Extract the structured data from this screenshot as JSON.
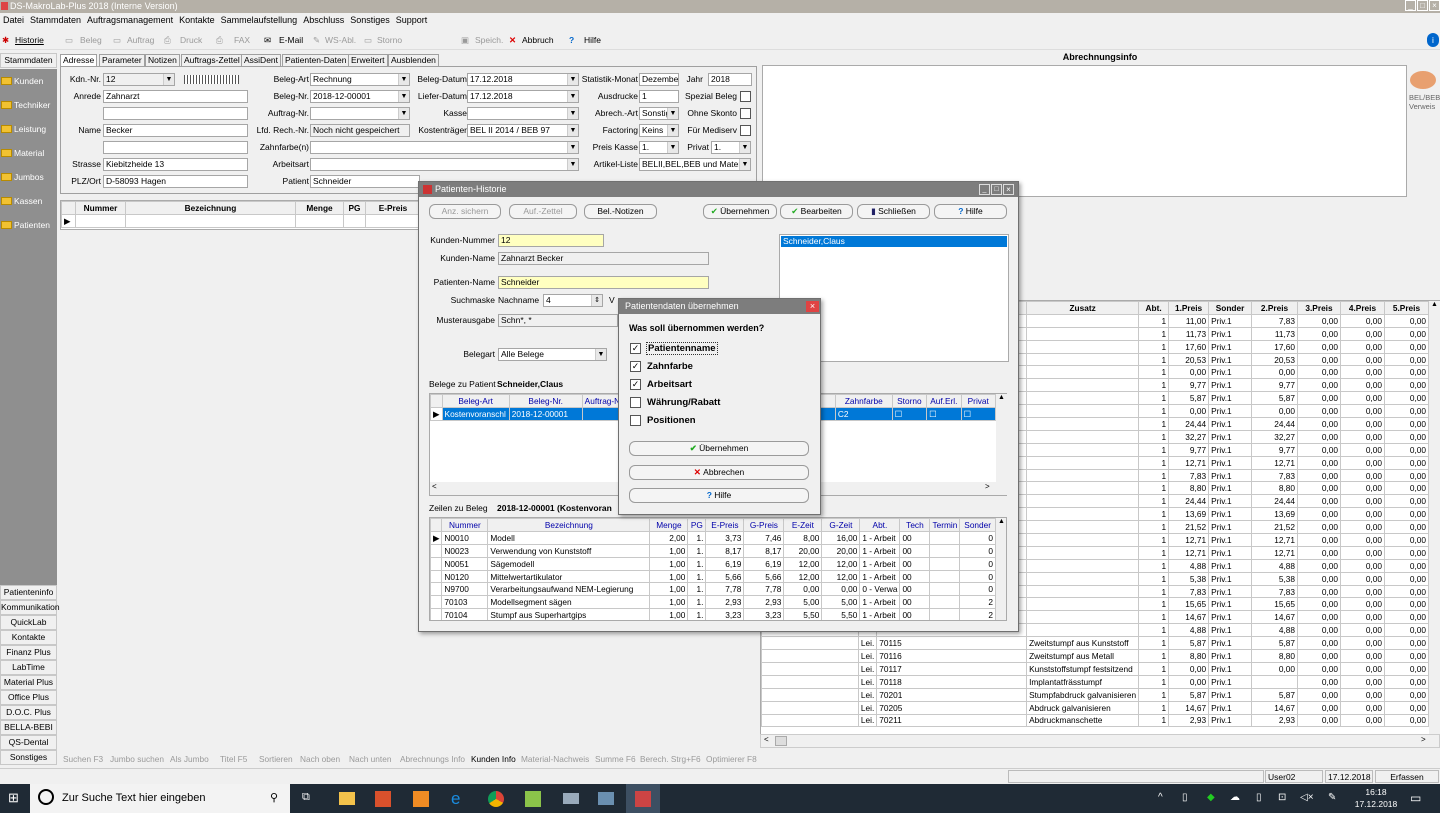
{
  "app": {
    "title": "DS-MakroLab-Plus 2018 (Interne Version)"
  },
  "menu": [
    "Datei",
    "Stammdaten",
    "Auftragsmanagement",
    "Kontakte",
    "Sammelaufstellung",
    "Abschluss",
    "Sonstiges",
    "Support"
  ],
  "toolbar": {
    "historie": "Historie",
    "beleg": "Beleg",
    "auftrag": "Auftrag",
    "druck": "Druck",
    "fax": "FAX",
    "email": "E-Mail",
    "wsabl": "WS-Abl.",
    "storno": "Storno",
    "speich": "Speich.",
    "abbruch": "Abbruch",
    "hilfe": "Hilfe"
  },
  "sidebar": {
    "header": "Stammdaten",
    "items": [
      "Kunden",
      "Techniker",
      "Leistung",
      "Material",
      "Jumbos",
      "Kassen",
      "Patienten"
    ],
    "bottom": [
      "Patienteninfo",
      "Kommunikation",
      "QuickLab",
      "Kontakte",
      "Finanz Plus",
      "LabTime",
      "Material Plus",
      "Office Plus",
      "D.O.C. Plus",
      "BELLA-BEBI",
      "QS-Dental",
      "Sonstiges"
    ]
  },
  "tabs": [
    "Adresse",
    "Parameter",
    "Notizen",
    "Auftrags-Zettel",
    "AssiDent",
    "Patienten-Daten",
    "Erweitert",
    "Ausblenden"
  ],
  "form": {
    "kdnr_label": "Kdn.-Nr.",
    "kdnr": "12",
    "anrede_label": "Anrede",
    "anrede": "Zahnarzt",
    "name_label": "Name",
    "name": "Becker",
    "strasse_label": "Strasse",
    "strasse": "Kiebitzheide 13",
    "plz_label": "PLZ/Ort",
    "plz": "D-58093 Hagen",
    "belegart_label": "Beleg-Art",
    "belegart": "Rechnung",
    "belegnr_label": "Beleg-Nr.",
    "belegnr": "2018-12-00001",
    "auftragnr_label": "Auftrag-Nr.",
    "lfdrech_label": "Lfd. Rech.-Nr.",
    "lfdrech": "Noch nicht gespeichert",
    "zahnfarbe_label": "Zahnfarbe(n)",
    "arbeitsart_label": "Arbeitsart",
    "patient_label": "Patient",
    "patient": "Schneider",
    "belegdatum_label": "Beleg-Datum",
    "belegdatum": "17.12.2018",
    "lieferdatum_label": "Liefer-Datum",
    "lieferdatum": "17.12.2018",
    "kasse_label": "Kasse",
    "kostentraeger_label": "Kostenträger",
    "kostentraeger": "BEL II 2014 / BEB 97",
    "statistik_label": "Statistik-Monat",
    "statistik": "Dezember",
    "jahr_label": "Jahr",
    "jahr": "2018",
    "ausdrucke_label": "Ausdrucke",
    "ausdrucke": "1",
    "abrechart_label": "Abrech.-Art",
    "abrechart": "Sonstig",
    "factoring_label": "Factoring",
    "factoring": "Keins",
    "preiskasse_label": "Preis Kasse",
    "preiskasse": "1.",
    "privat_label": "Privat",
    "privat": "1.",
    "artikelliste_label": "Artikel-Liste",
    "artikelliste": "BELII,BEL,BEB und Materi",
    "spezial_label": "Spezial Beleg",
    "skonto_label": "Ohne Skonto",
    "mediserv_label": "Für Mediserv"
  },
  "abrechnungsinfo": {
    "title": "Abrechnungsinfo",
    "icon_label": "BEL/BEB Verweis"
  },
  "main_grid": {
    "headers": [
      "Nummer",
      "Bezeichnung",
      "Menge",
      "PG",
      "E-Preis"
    ]
  },
  "right_grid": {
    "headers": [
      "Zusatz",
      "Abt.",
      "1.Preis",
      "Sonder",
      "2.Preis",
      "3.Preis",
      "4.Preis",
      "5.Preis"
    ],
    "rows": [
      [
        "1",
        "11,00",
        "Priv.1",
        "7,83",
        "0,00",
        "0,00",
        "0,00"
      ],
      [
        "1",
        "11,73",
        "Priv.1",
        "11,73",
        "0,00",
        "0,00",
        "0,00"
      ],
      [
        "1",
        "17,60",
        "Priv.1",
        "17,60",
        "0,00",
        "0,00",
        "0,00"
      ],
      [
        "1",
        "20,53",
        "Priv.1",
        "20,53",
        "0,00",
        "0,00",
        "0,00"
      ],
      [
        "1",
        "0,00",
        "Priv.1",
        "0,00",
        "0,00",
        "0,00",
        "0,00"
      ],
      [
        "1",
        "9,77",
        "Priv.1",
        "9,77",
        "0,00",
        "0,00",
        "0,00"
      ],
      [
        "1",
        "5,87",
        "Priv.1",
        "5,87",
        "0,00",
        "0,00",
        "0,00"
      ],
      [
        "1",
        "0,00",
        "Priv.1",
        "0,00",
        "0,00",
        "0,00",
        "0,00"
      ],
      [
        "1",
        "24,44",
        "Priv.1",
        "24,44",
        "0,00",
        "0,00",
        "0,00"
      ],
      [
        "1",
        "32,27",
        "Priv.1",
        "32,27",
        "0,00",
        "0,00",
        "0,00"
      ],
      [
        "1",
        "9,77",
        "Priv.1",
        "9,77",
        "0,00",
        "0,00",
        "0,00"
      ],
      [
        "1",
        "12,71",
        "Priv.1",
        "12,71",
        "0,00",
        "0,00",
        "0,00"
      ],
      [
        "1",
        "7,83",
        "Priv.1",
        "7,83",
        "0,00",
        "0,00",
        "0,00"
      ],
      [
        "1",
        "8,80",
        "Priv.1",
        "8,80",
        "0,00",
        "0,00",
        "0,00"
      ],
      [
        "1",
        "24,44",
        "Priv.1",
        "24,44",
        "0,00",
        "0,00",
        "0,00"
      ],
      [
        "1",
        "13,69",
        "Priv.1",
        "13,69",
        "0,00",
        "0,00",
        "0,00"
      ],
      [
        "1",
        "21,52",
        "Priv.1",
        "21,52",
        "0,00",
        "0,00",
        "0,00"
      ],
      [
        "1",
        "12,71",
        "Priv.1",
        "12,71",
        "0,00",
        "0,00",
        "0,00"
      ],
      [
        "1",
        "12,71",
        "Priv.1",
        "12,71",
        "0,00",
        "0,00",
        "0,00"
      ],
      [
        "1",
        "4,88",
        "Priv.1",
        "4,88",
        "0,00",
        "0,00",
        "0,00"
      ],
      [
        "1",
        "5,38",
        "Priv.1",
        "5,38",
        "0,00",
        "0,00",
        "0,00"
      ],
      [
        "1",
        "7,83",
        "Priv.1",
        "7,83",
        "0,00",
        "0,00",
        "0,00"
      ],
      [
        "1",
        "15,65",
        "Priv.1",
        "15,65",
        "0,00",
        "0,00",
        "0,00"
      ],
      [
        "1",
        "14,67",
        "Priv.1",
        "14,67",
        "0,00",
        "0,00",
        "0,00"
      ],
      [
        "1",
        "4,88",
        "Priv.1",
        "4,88",
        "0,00",
        "0,00",
        "0,00"
      ]
    ],
    "lower_rows": [
      [
        "Lei.",
        "70115",
        "Zweitstumpf aus Kunststoff",
        "1",
        "5,87",
        "Priv.1",
        "5,87",
        "0,00",
        "0,00",
        "0,00"
      ],
      [
        "Lei.",
        "70116",
        "Zweitstumpf aus Metall",
        "1",
        "8,80",
        "Priv.1",
        "8,80",
        "0,00",
        "0,00",
        "0,00"
      ],
      [
        "Lei.",
        "70117",
        "Kunststoffstumpf festsitzend",
        "1",
        "0,00",
        "Priv.1",
        "0,00",
        "0,00",
        "0,00",
        "0,00"
      ],
      [
        "Lei.",
        "70118",
        "Implantatfrässtumpf",
        "1",
        "0,00",
        "Priv.1",
        "",
        "0,00",
        "0,00",
        "0,00"
      ],
      [
        "Lei.",
        "70201",
        "Stumpfabdruck galvanisieren",
        "1",
        "5,87",
        "Priv.1",
        "5,87",
        "0,00",
        "0,00",
        "0,00"
      ],
      [
        "Lei.",
        "70205",
        "Abdruck galvanisieren",
        "1",
        "14,67",
        "Priv.1",
        "14,67",
        "0,00",
        "0,00",
        "0,00"
      ],
      [
        "Lei.",
        "70211",
        "Abdruckmanschette",
        "1",
        "2,93",
        "Priv.1",
        "2,93",
        "0,00",
        "0,00",
        "0,00"
      ]
    ]
  },
  "hist": {
    "title": "Patienten-Historie",
    "btn_anz": "Anz. sichern",
    "btn_auf": "Auf.-Zettel",
    "btn_bel": "Bel.-Notizen",
    "btn_ueber": "Übernehmen",
    "btn_bearb": "Bearbeiten",
    "btn_schl": "Schließen",
    "btn_hilfe": "Hilfe",
    "kundennr_label": "Kunden-Nummer",
    "kundennr": "12",
    "kundenname_label": "Kunden-Name",
    "kundenname": "Zahnarzt Becker",
    "patname_label": "Patienten-Name",
    "patname": "Schneider",
    "suchmaske_label": "Suchmaske",
    "nachname_label": "Nachname",
    "nachname_num": "4",
    "vorname_label": "V",
    "muster_label": "Musterausgabe",
    "muster": "Schn*, *",
    "belegart_label": "Belegart",
    "belegart": "Alle Belege",
    "list_item": "Schneider,Claus",
    "belege_label": "Belege zu Patient",
    "belege_patient": "Schneider,Claus",
    "beleg_headers": [
      "Beleg-Art",
      "Beleg-Nr.",
      "Auftrag-N",
      "Zahnfarbe",
      "Storno",
      "Auf.Erl.",
      "Privat"
    ],
    "beleg_row": {
      "art": "Kostenvoranschl",
      "nr": "2018-12-00001",
      "zf": "C2"
    },
    "zeilen_label": "Zeilen zu Beleg",
    "zeilen_beleg": "2018-12-00001 (Kostenvoran",
    "zeilen_headers": [
      "Nummer",
      "Bezeichnung",
      "Menge",
      "PG",
      "E-Preis",
      "G-Preis",
      "E-Zeit",
      "G-Zeit",
      "Abt.",
      "Tech",
      "Termin",
      "Sonder"
    ],
    "zeilen": [
      [
        "N0010",
        "Modell",
        "2,00",
        "1.",
        "3,73",
        "7,46",
        "8,00",
        "16,00",
        "1 - Arbeit",
        "00",
        "",
        "0"
      ],
      [
        "N0023",
        "Verwendung von Kunststoff",
        "1,00",
        "1.",
        "8,17",
        "8,17",
        "20,00",
        "20,00",
        "1 - Arbeit",
        "00",
        "",
        "0"
      ],
      [
        "N0051",
        "Sägemodell",
        "1,00",
        "1.",
        "6,19",
        "6,19",
        "12,00",
        "12,00",
        "1 - Arbeit",
        "00",
        "",
        "0"
      ],
      [
        "N0120",
        "Mittelwertartikulator",
        "1,00",
        "1.",
        "5,66",
        "5,66",
        "12,00",
        "12,00",
        "1 - Arbeit",
        "00",
        "",
        "0"
      ],
      [
        "N9700",
        "Verarbeitungsaufwand NEM-Legierung",
        "1,00",
        "1.",
        "7,78",
        "7,78",
        "0,00",
        "0,00",
        "0 - Verwa",
        "00",
        "",
        "0"
      ],
      [
        "70103",
        "Modellsegment sägen",
        "1,00",
        "1.",
        "2,93",
        "2,93",
        "5,00",
        "5,00",
        "1 - Arbeit",
        "00",
        "",
        "2"
      ],
      [
        "70104",
        "Stumpf aus Superhartgips",
        "1,00",
        "1.",
        "3,23",
        "3,23",
        "5,50",
        "5,50",
        "1 - Arbeit",
        "00",
        "",
        "2"
      ]
    ]
  },
  "dlg": {
    "title": "Patientendaten übernehmen",
    "question": "Was soll übernommen werden?",
    "options": [
      "Patientenname",
      "Zahnfarbe",
      "Arbeitsart",
      "Währung/Rabatt",
      "Positionen"
    ],
    "checked": [
      true,
      true,
      true,
      false,
      false
    ],
    "btn_ok": "Übernehmen",
    "btn_cancel": "Abbrechen",
    "btn_help": "Hilfe"
  },
  "hints": [
    "Suchen F3",
    "Jumbo suchen",
    "Als Jumbo",
    "Titel F5",
    "Sortieren",
    "Nach oben",
    "Nach unten",
    "Abrechnungs Info",
    "Kunden Info",
    "Material-Nachweis",
    "Summe F6",
    "Berech. Strg+F6",
    "Optimierer F8"
  ],
  "status": {
    "user": "User02",
    "date": "17.12.2018",
    "mode": "Erfassen"
  },
  "taskbar": {
    "search": "Zur Suche Text hier eingeben",
    "time": "16:18",
    "date": "17.12.2018"
  }
}
